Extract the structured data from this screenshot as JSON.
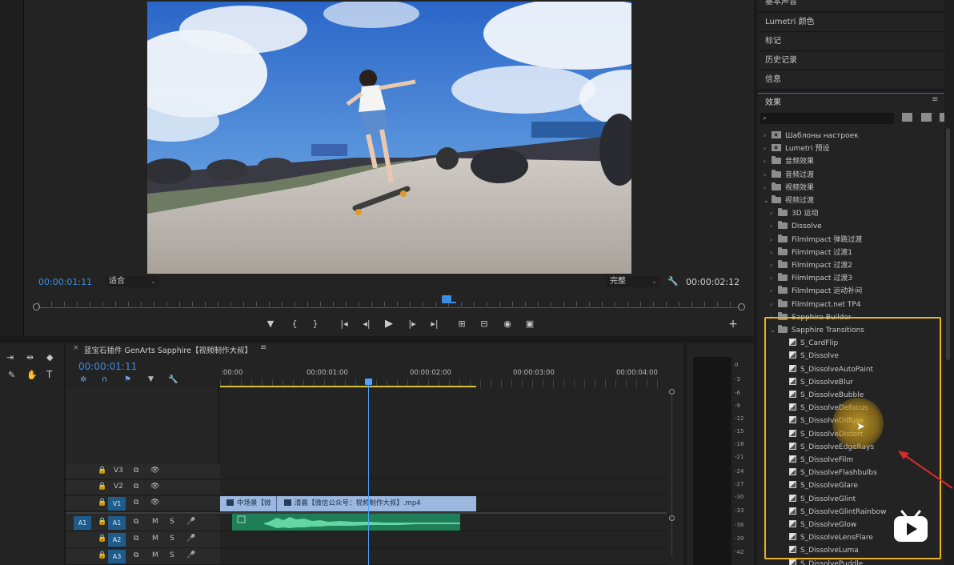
{
  "monitor": {
    "timecode_current": "00:00:01:11",
    "fit_select": "适合",
    "quality_select": "完整",
    "timecode_duration": "00:00:02:12"
  },
  "transport_icons": [
    "marker-icon",
    "in-point-icon",
    "out-point-icon",
    "go-to-in-icon",
    "step-back-icon",
    "play-icon",
    "step-forward-icon",
    "go-to-out-icon",
    "lift-icon",
    "extract-icon",
    "export-frame-icon",
    "compare-icon",
    "add-button-icon"
  ],
  "timeline": {
    "sequence_title": "蓝宝石插件 GenArts Sapphire【视频制作大叔】",
    "timecode": "00:00:01:11",
    "ruler_labels": [
      ":00:00",
      "00:00:01:00",
      "00:00:02:00",
      "00:00:03:00",
      "00:00:04:00"
    ],
    "video_tracks": [
      {
        "label": "V3"
      },
      {
        "label": "V2"
      },
      {
        "label": "V1"
      }
    ],
    "audio_tracks": [
      {
        "source": "A1",
        "label": "A1",
        "m": "M",
        "s": "S"
      },
      {
        "label": "A2",
        "m": "M",
        "s": "S"
      },
      {
        "label": "A3",
        "m": "M",
        "s": "S"
      }
    ],
    "clip_a": "中场景【微",
    "clip_b": "清晨【微信公众号：视频制作大叔】.mp4"
  },
  "meter_db": [
    "0",
    "-3",
    "-6",
    "-9",
    "-12",
    "-15",
    "-18",
    "-21",
    "-24",
    "-27",
    "-30",
    "-33",
    "-36",
    "-39",
    "-42"
  ],
  "panels": [
    "基本声音",
    "Lumetri 颜色",
    "标记",
    "历史记录",
    "信息"
  ],
  "effects": {
    "title": "效果",
    "search_placeholder": "",
    "tree": [
      {
        "label": "Шаблоны настроек",
        "kind": "bin",
        "depth": 0
      },
      {
        "label": "Lumetri 预设",
        "kind": "bin",
        "depth": 0
      },
      {
        "label": "音频效果",
        "kind": "folder",
        "depth": 0
      },
      {
        "label": "音频过渡",
        "kind": "folder",
        "depth": 0
      },
      {
        "label": "视频效果",
        "kind": "folder",
        "depth": 0
      },
      {
        "label": "视频过渡",
        "kind": "folder",
        "depth": 0,
        "open": true
      },
      {
        "label": "3D 运动",
        "kind": "folder",
        "depth": 1
      },
      {
        "label": "Dissolve",
        "kind": "folder",
        "depth": 1
      },
      {
        "label": "FilmImpact 弹跳过渡",
        "kind": "folder",
        "depth": 1
      },
      {
        "label": "FilmImpact 过渡1",
        "kind": "folder",
        "depth": 1
      },
      {
        "label": "FilmImpact 过渡2",
        "kind": "folder",
        "depth": 1
      },
      {
        "label": "FilmImpact 过渡3",
        "kind": "folder",
        "depth": 1
      },
      {
        "label": "FilmImpact 运动补间",
        "kind": "folder",
        "depth": 1
      },
      {
        "label": "FilmImpact.net TP4",
        "kind": "folder",
        "depth": 1
      },
      {
        "label": "Sapphire Builder",
        "kind": "folder",
        "depth": 1
      },
      {
        "label": "Sapphire Transitions",
        "kind": "folder",
        "depth": 1,
        "open": true
      },
      {
        "label": "S_CardFlip",
        "kind": "effect",
        "depth": 2
      },
      {
        "label": "S_Dissolve",
        "kind": "effect",
        "depth": 2
      },
      {
        "label": "S_DissolveAutoPaint",
        "kind": "effect",
        "depth": 2
      },
      {
        "label": "S_DissolveBlur",
        "kind": "effect",
        "depth": 2
      },
      {
        "label": "S_DissolveBubble",
        "kind": "effect",
        "depth": 2
      },
      {
        "label": "S_DissolveDefocus",
        "kind": "effect",
        "depth": 2
      },
      {
        "label": "S_DissolveDiffuse",
        "kind": "effect",
        "depth": 2
      },
      {
        "label": "S_DissolveDistort",
        "kind": "effect",
        "depth": 2
      },
      {
        "label": "S_DissolveEdgeRays",
        "kind": "effect",
        "depth": 2
      },
      {
        "label": "S_DissolveFilm",
        "kind": "effect",
        "depth": 2
      },
      {
        "label": "S_DissolveFlashbulbs",
        "kind": "effect",
        "depth": 2
      },
      {
        "label": "S_DissolveGlare",
        "kind": "effect",
        "depth": 2
      },
      {
        "label": "S_DissolveGlint",
        "kind": "effect",
        "depth": 2
      },
      {
        "label": "S_DissolveGlintRainbow",
        "kind": "effect",
        "depth": 2
      },
      {
        "label": "S_DissolveGlow",
        "kind": "effect",
        "depth": 2
      },
      {
        "label": "S_DissolveLensFlare",
        "kind": "effect",
        "depth": 2
      },
      {
        "label": "S_DissolveLuma",
        "kind": "effect",
        "depth": 2
      },
      {
        "label": "S_DissolvePuddle",
        "kind": "effect",
        "depth": 2
      }
    ]
  },
  "colors": {
    "accent_blue": "#3a8ee6",
    "highlight": "#e8b421",
    "video_clip": "#9bb8e0",
    "audio_clip": "#1e7e57"
  }
}
